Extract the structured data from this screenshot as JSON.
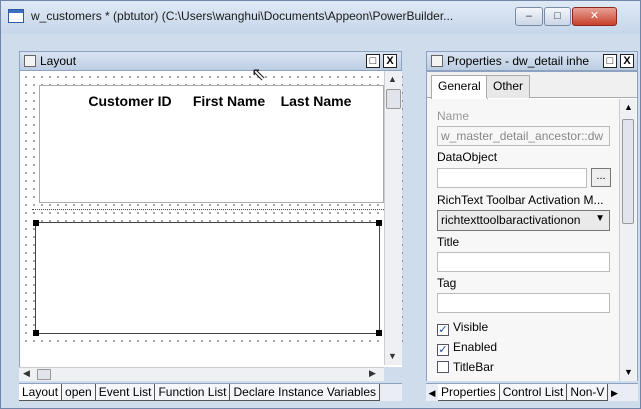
{
  "window": {
    "title": "w_customers * (pbtutor) (C:\\Users\\wanghui\\Documents\\Appeon\\PowerBuilder...",
    "min_label": "–",
    "max_label": "□",
    "close_label": "✕"
  },
  "layout": {
    "pane_title": "Layout",
    "restore_label": "□",
    "close_label": "X",
    "columns": {
      "customer_id": "Customer ID",
      "first_name": "First Name",
      "last_name": "Last Name"
    },
    "bottom_tabs": [
      "Layout",
      "open",
      "Event List",
      "Function List",
      "Declare Instance Variables"
    ]
  },
  "properties": {
    "pane_title": "Properties - dw_detail inhe",
    "restore_label": "□",
    "close_label": "X",
    "tabs": [
      "General",
      "Other"
    ],
    "name_label": "Name",
    "name_value": "w_master_detail_ancestor::dw",
    "dataobject_label": "DataObject",
    "dataobject_value": "",
    "dots_label": "...",
    "richtext_label": "RichText Toolbar Activation M...",
    "richtext_value": "richtexttoolbaractivationon",
    "title_label": "Title",
    "title_value": "",
    "tag_label": "Tag",
    "tag_value": "",
    "checkboxes": [
      {
        "label": "Visible",
        "checked": true
      },
      {
        "label": "Enabled",
        "checked": true
      },
      {
        "label": "TitleBar",
        "checked": false
      }
    ],
    "bottom_tabs": [
      "Properties",
      "Control List",
      "Non-V"
    ]
  },
  "icons": [
    "window-icon",
    "layout-pane-icon",
    "properties-pane-icon",
    "mouse-cursor-icon"
  ]
}
